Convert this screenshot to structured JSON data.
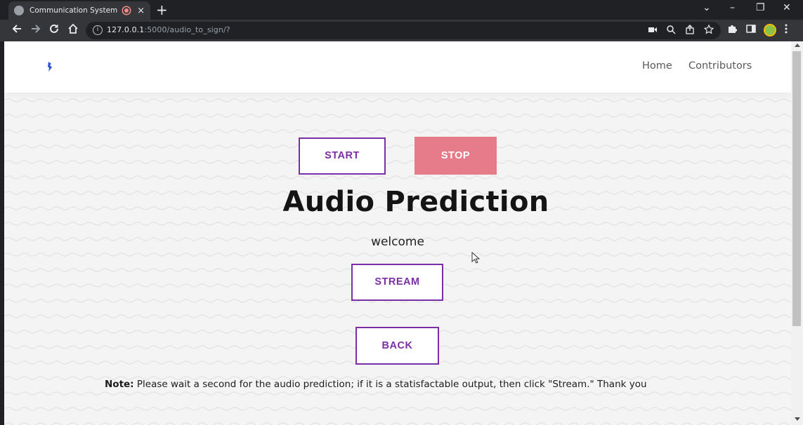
{
  "browser": {
    "tab_title": "Communication System for Spe",
    "tab_close": "×",
    "new_tab": "+",
    "url_host": "127.0.0.1",
    "url_path": ":5000/audio_to_sign/?",
    "window_controls": {
      "dropdown": "⌄",
      "minimize": "–",
      "restore": "❐",
      "close": "✕"
    }
  },
  "site": {
    "nav": {
      "home": "Home",
      "contributors": "Contributors"
    }
  },
  "main": {
    "start_label": "START",
    "stop_label": "STOP",
    "title": "Audio Prediction",
    "welcome": "welcome",
    "stream_label": "STREAM",
    "back_label": "BACK",
    "note_label": "Note:",
    "note_text": " Please wait a second for the audio prediction; if it is a statisfactable output, then click \"Stream.\" Thank you"
  },
  "colors": {
    "accent_purple": "#7b2fa6",
    "stop_pink": "#e67c8a",
    "logo_blue": "#2f55d4"
  }
}
